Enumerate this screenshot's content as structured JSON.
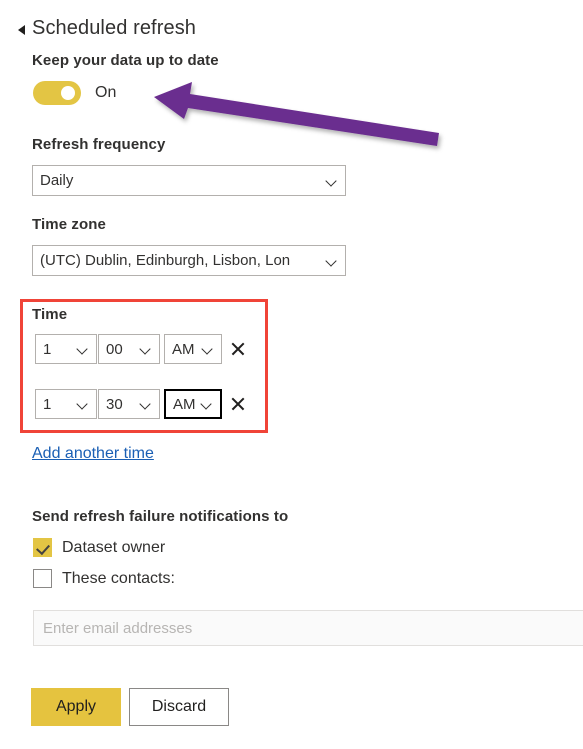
{
  "section": {
    "title": "Scheduled refresh",
    "collapse_icon": "triangle-collapse-icon"
  },
  "keep_up_to_date": {
    "label": "Keep your data up to date",
    "toggle_state": "On",
    "toggle_on": true,
    "toggle_color": "#e3c544"
  },
  "refresh_frequency": {
    "label": "Refresh frequency",
    "value": "Daily"
  },
  "time_zone": {
    "label": "Time zone",
    "value": "(UTC) Dublin, Edinburgh, Lisbon, Lon"
  },
  "time": {
    "label": "Time",
    "rows": [
      {
        "hour": "1",
        "minute": "00",
        "meridiem": "AM",
        "remove_icon": "close-icon",
        "focused": false
      },
      {
        "hour": "1",
        "minute": "30",
        "meridiem": "AM",
        "remove_icon": "close-icon",
        "focused": true
      }
    ],
    "add_link": "Add another time",
    "highlight_color": "#f04438"
  },
  "notifications": {
    "label": "Send refresh failure notifications to",
    "dataset_owner": {
      "label": "Dataset owner",
      "checked": true
    },
    "these_contacts": {
      "label": "These contacts:",
      "checked": false
    },
    "email_placeholder": "Enter email addresses",
    "email_value": ""
  },
  "actions": {
    "apply_label": "Apply",
    "discard_label": "Discard",
    "apply_color": "#e5c33f"
  },
  "annotations": {
    "arrow_color": "#6b2d8f",
    "arrow_target": "toggle"
  }
}
